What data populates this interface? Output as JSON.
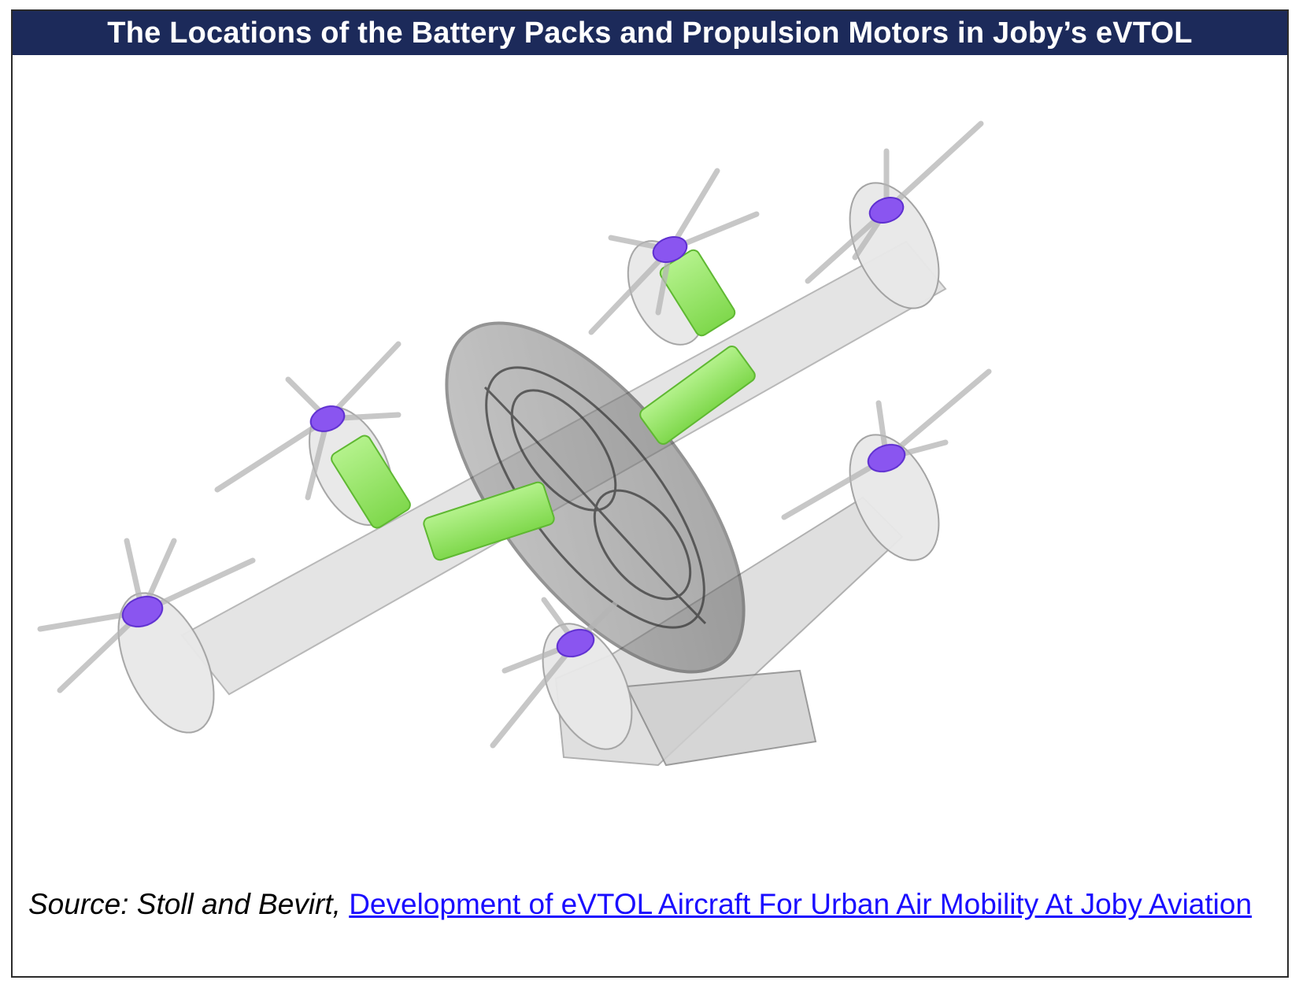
{
  "header": {
    "title": "The Locations of the Battery Packs and Propulsion Motors in Joby’s eVTOL"
  },
  "figure": {
    "battery_color": "#8ee65a",
    "motor_color": "#8a55f0",
    "airframe_color": "#e2e2e2"
  },
  "footer": {
    "source_prefix": "Source: Stoll and Bevirt, ",
    "source_link": "Development of eVTOL Aircraft For Urban Air Mobility At Joby Aviation"
  }
}
